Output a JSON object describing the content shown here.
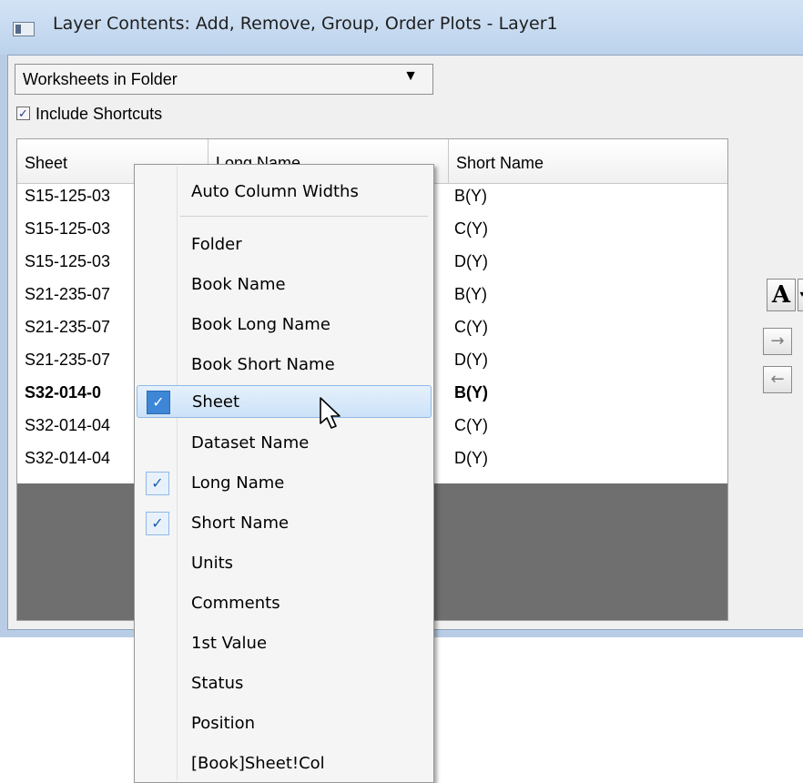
{
  "window": {
    "title": "Layer Contents: Add, Remove, Group, Order Plots - Layer1"
  },
  "filter": {
    "selected": "Worksheets in Folder",
    "include_shortcuts_label": "Include Shortcuts",
    "include_shortcuts_checked": true
  },
  "table": {
    "columns": [
      "Sheet",
      "Long Name",
      "Short Name"
    ],
    "rows": [
      {
        "sheet": "S15-125-03",
        "short": "B(Y)"
      },
      {
        "sheet": "S15-125-03",
        "short": "C(Y)"
      },
      {
        "sheet": "S15-125-03",
        "short": "D(Y)"
      },
      {
        "sheet": "S21-235-07",
        "short": "B(Y)"
      },
      {
        "sheet": "S21-235-07",
        "short": "C(Y)"
      },
      {
        "sheet": "S21-235-07",
        "short": "D(Y)"
      },
      {
        "sheet": "S32-014-0",
        "short": "B(Y)"
      },
      {
        "sheet": "S32-014-04",
        "short": "C(Y)"
      },
      {
        "sheet": "S32-014-04",
        "short": "D(Y)"
      }
    ]
  },
  "side_buttons": {
    "font_label": "A",
    "add_arrow": "→",
    "remove_arrow": "←"
  },
  "context_menu": {
    "items": [
      {
        "label": "Auto Column Widths",
        "checked": false
      },
      {
        "label": "Folder",
        "checked": false
      },
      {
        "label": "Book Name",
        "checked": false
      },
      {
        "label": "Book Long Name",
        "checked": false
      },
      {
        "label": "Book Short Name",
        "checked": false
      },
      {
        "label": "Sheet",
        "checked": true
      },
      {
        "label": "Dataset Name",
        "checked": false
      },
      {
        "label": "Long Name",
        "checked": true
      },
      {
        "label": "Short Name",
        "checked": true
      },
      {
        "label": "Units",
        "checked": false
      },
      {
        "label": "Comments",
        "checked": false
      },
      {
        "label": "1st Value",
        "checked": false
      },
      {
        "label": "Status",
        "checked": false
      },
      {
        "label": "Position",
        "checked": false
      },
      {
        "label": "[Book]Sheet!Col",
        "checked": false
      }
    ],
    "highlighted": "Sheet",
    "check_glyph": "✓"
  },
  "colors": {
    "title_bar": "#c6d9f0",
    "menu_highlight": "#cce2f8",
    "check_active": "#3e86d6",
    "grid_empty": "#6f6f6f"
  }
}
